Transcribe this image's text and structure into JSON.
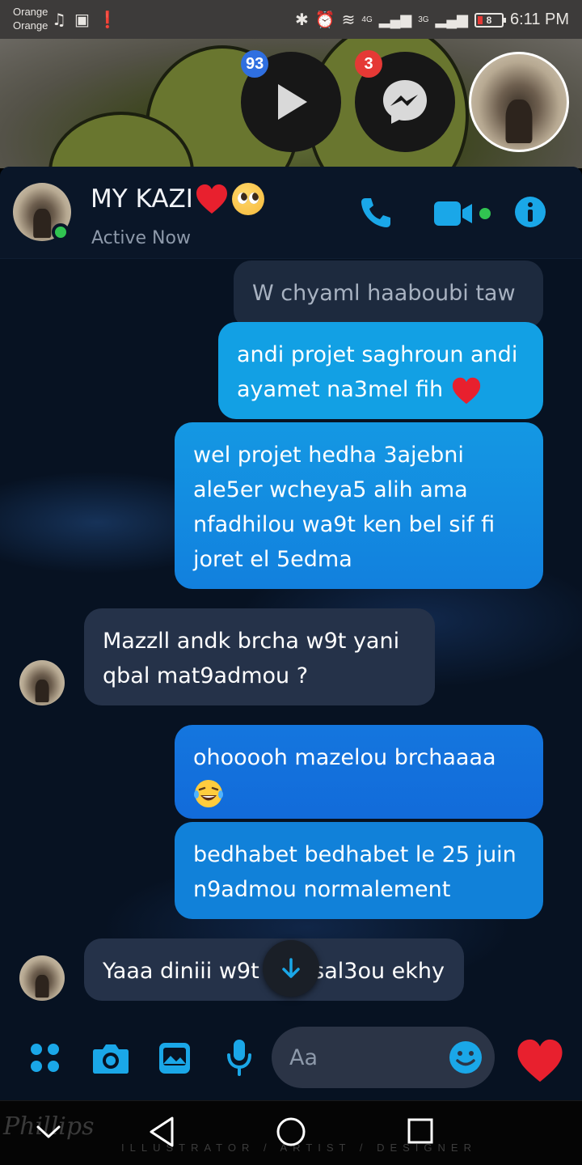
{
  "status_bar": {
    "carrier_1": "Orange",
    "carrier_2": "Orange",
    "network_1": "4G",
    "network_2": "3G",
    "battery": "8",
    "time": "6:11 PM"
  },
  "chat_heads": [
    {
      "icon": "play-icon",
      "badge": "93",
      "badge_color": "#2f6fe0"
    },
    {
      "icon": "messenger-icon",
      "badge": "3",
      "badge_color": "#e53935"
    },
    {
      "icon": "contact-photo"
    }
  ],
  "conversation": {
    "contact_name": "MY KAZI",
    "status": "Active Now",
    "accent_color": "#1aa7e8"
  },
  "messages": [
    {
      "from": "contact",
      "text": "W chyaml haaboubi taw"
    },
    {
      "from": "me",
      "text": "andi projet saghroun andi ayamet na3mel fih"
    },
    {
      "from": "me",
      "text": "wel projet hedha 3ajebni ale5er wcheya5 alih ama nfadhilou wa9t ken bel sif fi joret el 5edma"
    },
    {
      "from": "contact",
      "text": "Mazzll  andk brcha w9t yani qbal mat9admou ?"
    },
    {
      "from": "me",
      "text": "ohooooh mazelou brchaaaa"
    },
    {
      "from": "me",
      "text": "bedhabet bedhabet le 25 juin n9admou normalement"
    },
    {
      "from": "contact",
      "text_left": "Yaaa diniii w9t",
      "text_right": "sal3ou ekhy"
    }
  ],
  "composer": {
    "placeholder": "Aa"
  },
  "navbar": {
    "watermark": "ILLUSTRATOR / ARTIST / DESIGNER",
    "signature": "Phillips"
  }
}
